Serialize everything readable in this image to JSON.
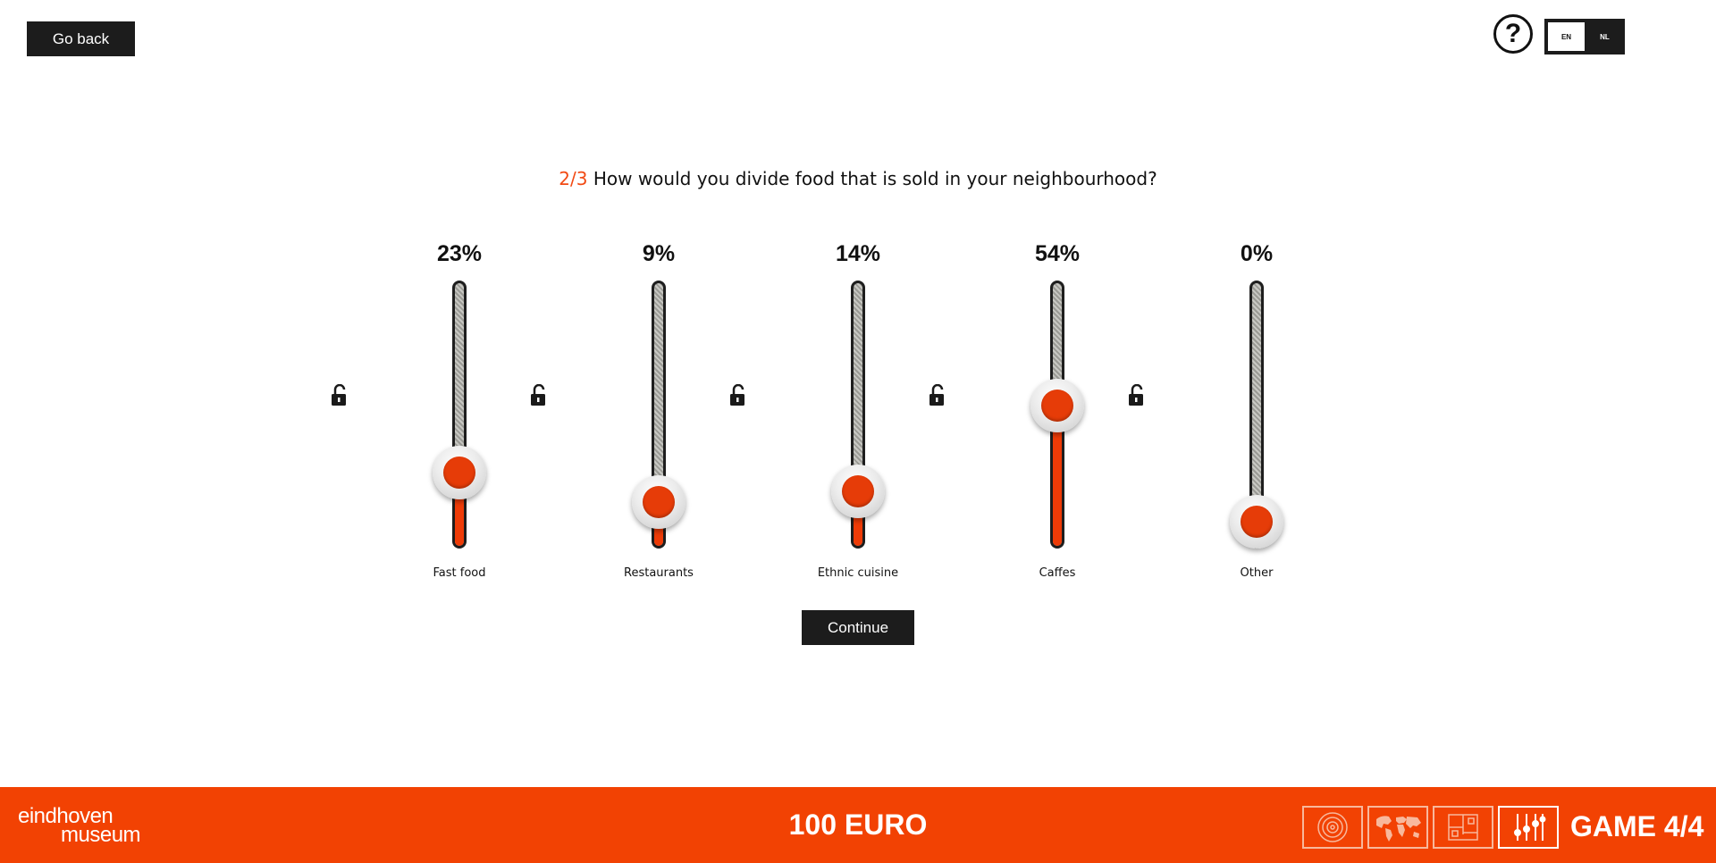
{
  "header": {
    "go_back_label": "Go back",
    "help_symbol": "?",
    "help_icon": "question-mark-icon",
    "languages": {
      "en": "EN",
      "nl": "NL",
      "active": "EN"
    }
  },
  "question": {
    "step": "2/3",
    "text": "How would you divide food that is sold in your neighbourhood?"
  },
  "sliders": [
    {
      "label": "Fast food",
      "percent_text": "23%",
      "value": 23,
      "locked": false
    },
    {
      "label": "Restaurants",
      "percent_text": "9%",
      "value": 9,
      "locked": false
    },
    {
      "label": "Ethnic cuisine",
      "percent_text": "14%",
      "value": 14,
      "locked": false
    },
    {
      "label": "Caffes",
      "percent_text": "54%",
      "value": 54,
      "locked": false
    },
    {
      "label": "Other",
      "percent_text": "0%",
      "value": 0,
      "locked": false
    }
  ],
  "continue_label": "Continue",
  "footer": {
    "logo_line1": "eindhoven",
    "logo_line2": "museum",
    "budget": "100 EURO",
    "game_label": "GAME 4/4",
    "game_icons": [
      "target-icon",
      "world-map-icon",
      "floor-plan-icon",
      "sliders-icon"
    ],
    "active_game_icon": "sliders-icon"
  },
  "colors": {
    "accent": "#f24203",
    "knob_red": "#e63c08",
    "dark": "#1c1c1c"
  }
}
